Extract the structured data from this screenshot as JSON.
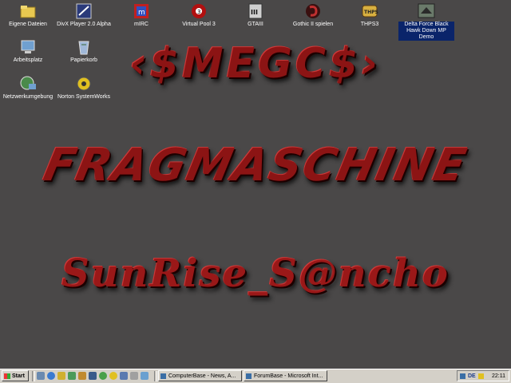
{
  "desktop": {
    "icons": [
      {
        "label": "Eigene Dateien",
        "icon": "folder-icon",
        "color": "#e8c850"
      },
      {
        "label": "DivX Player 2.0 Alpha",
        "icon": "divx-icon",
        "color": "#2a3a7a"
      },
      {
        "label": "mIRC",
        "icon": "mirc-icon",
        "color": "#c02020"
      },
      {
        "label": "Virtual Pool 3",
        "icon": "pool-icon",
        "color": "#b01010"
      },
      {
        "label": "GTAIII",
        "icon": "gta-icon",
        "color": "#d0d0d0"
      },
      {
        "label": "Gothic II spielen",
        "icon": "gothic-icon",
        "color": "#8a2020"
      },
      {
        "label": "THPS3",
        "icon": "thps-icon",
        "color": "#d8b040"
      },
      {
        "label": "Delta Force Black Hawk Down MP Demo",
        "icon": "deltaforce-icon",
        "color": "#6a7a6a"
      },
      {
        "label": "Arbeitsplatz",
        "icon": "computer-icon",
        "color": "#70a0d0"
      },
      {
        "label": "Papierkorb",
        "icon": "recycle-bin-icon",
        "color": "#a0b8d8"
      },
      {
        "label": "Netzwerkumgebung",
        "icon": "network-icon",
        "color": "#4a8a4a"
      },
      {
        "label": "Norton SystemWorks",
        "icon": "norton-icon",
        "color": "#e0c020"
      }
    ],
    "art": {
      "line1": "‹$MEGC$›",
      "line2": "FRAGMASCHINE",
      "line3": "SunRise_S@ncho"
    },
    "colors": {
      "background": "#4a4848",
      "art_red": "#8c1414"
    }
  },
  "taskbar": {
    "start_label": "Start",
    "quicklaunch": [
      "desktop-icon",
      "ie-icon",
      "outlook-icon",
      "media-icon",
      "explorer-icon",
      "winamp-icon",
      "messenger-icon",
      "norton-icon",
      "app-icon"
    ],
    "tasks": [
      {
        "label": "ComputerBase - News, A...",
        "icon": "ie-icon"
      },
      {
        "label": "ForumBase - Microsoft Int...",
        "icon": "ie-icon"
      }
    ],
    "tray": {
      "language": "DE",
      "clock": "22:11"
    }
  }
}
